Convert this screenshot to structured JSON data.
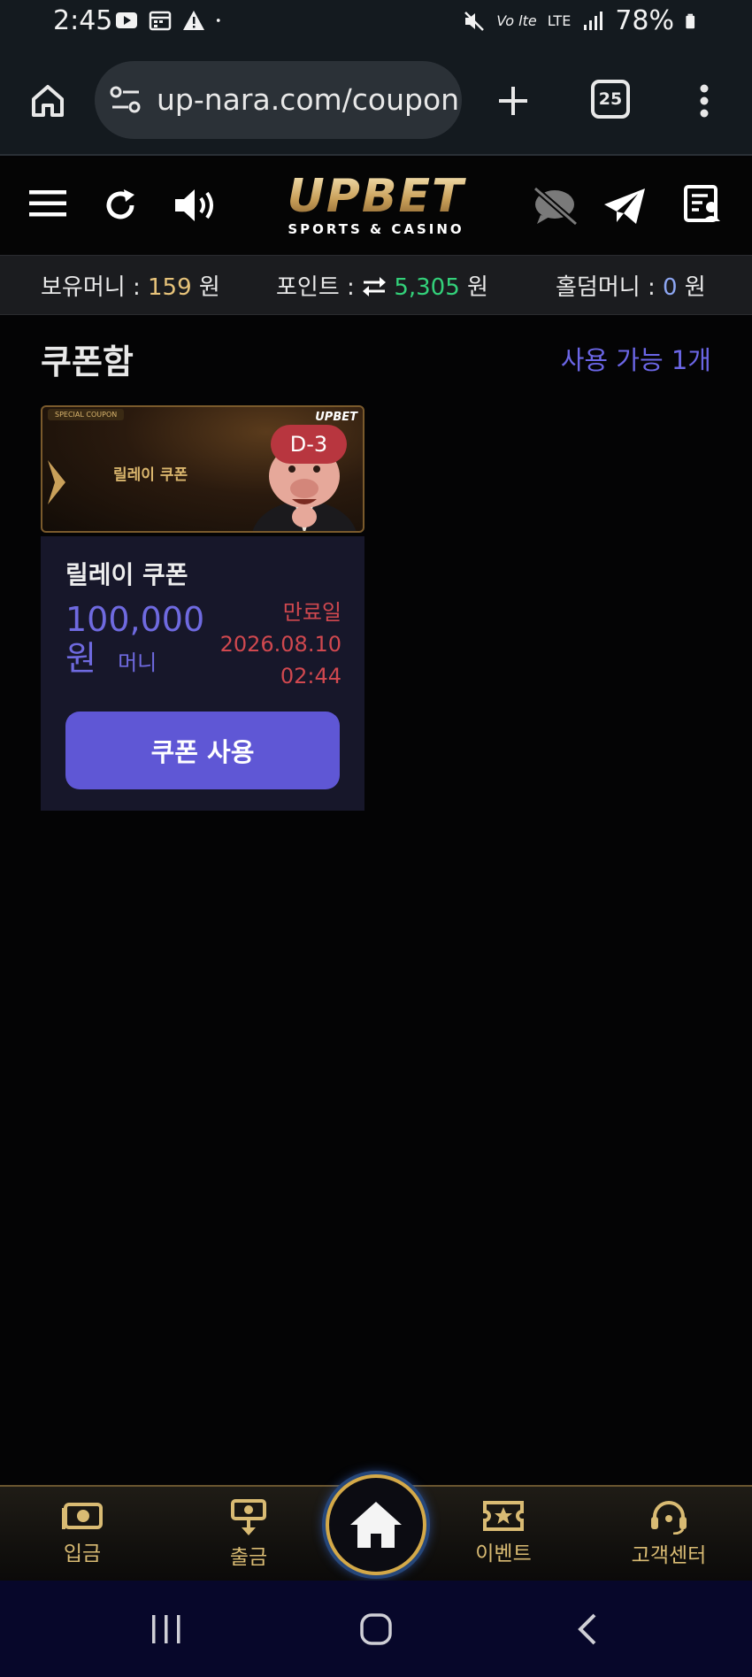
{
  "status_bar": {
    "time": "2:45",
    "battery": "78%",
    "network": "LTE"
  },
  "browser": {
    "url": "up-nara.com/coupon",
    "tab_count": "25"
  },
  "header": {
    "logo_main": "UPBET",
    "logo_sub": "SPORTS & CASINO"
  },
  "balances": {
    "money_label": "보유머니 :",
    "money_value": "159",
    "point_label": "포인트 :",
    "point_value": "5,305",
    "holdem_label": "홀덤머니 :",
    "holdem_value": "0",
    "unit": "원"
  },
  "coupon_box": {
    "title": "쿠폰함",
    "available": "사용 가능 1개",
    "coupons": [
      {
        "banner_tag": "SPECIAL COUPON",
        "banner_title": "릴레이 쿠폰",
        "banner_logo": "UPBET",
        "d_day": "D-3",
        "name": "릴레이 쿠폰",
        "amount": "100,000",
        "amount_unit": "원",
        "type": "머니",
        "expiry_label": "만료일",
        "expiry_date": "2026.08.10",
        "expiry_time": "02:44",
        "use_button": "쿠폰 사용"
      }
    ]
  },
  "bottom_nav": {
    "deposit": "입금",
    "withdraw": "출금",
    "event": "이벤트",
    "support": "고객센터"
  },
  "colors": {
    "accent_purple": "#5f57d5",
    "gold": "#d9bb73",
    "expiry_red": "#d0484f"
  }
}
